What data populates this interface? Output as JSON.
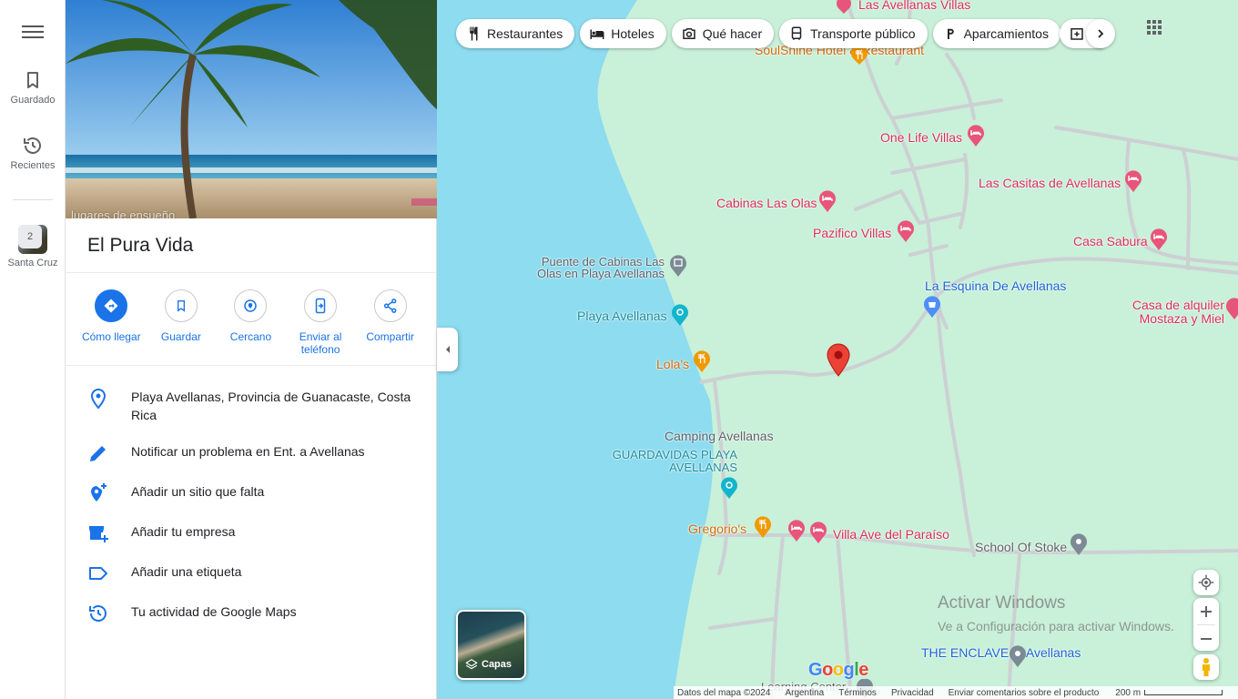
{
  "rail": {
    "saved_label": "Guardado",
    "recent_label": "Recientes",
    "recent_place_label": "Santa Cruz",
    "recent_badge": "2"
  },
  "panel": {
    "hero_caption": "lugares de ensueño",
    "title": "El Pura Vida",
    "actions": [
      {
        "label": "Cómo llegar",
        "icon": "directions-icon"
      },
      {
        "label": "Guardar",
        "icon": "bookmark-icon"
      },
      {
        "label": "Cercano",
        "icon": "nearby-icon"
      },
      {
        "label": "Enviar al teléfono",
        "icon": "send-to-phone-icon"
      },
      {
        "label": "Compartir",
        "icon": "share-icon"
      }
    ],
    "info": [
      {
        "text": "Playa Avellanas, Provincia de Guanacaste, Costa Rica",
        "icon": "location-pin-icon"
      },
      {
        "text": "Notificar un problema en Ent. a Avellanas",
        "icon": "pencil-icon"
      },
      {
        "text": "Añadir un sitio que falta",
        "icon": "add-place-icon"
      },
      {
        "text": "Añadir tu empresa",
        "icon": "add-business-icon"
      },
      {
        "text": "Añadir una etiqueta",
        "icon": "label-icon"
      },
      {
        "text": "Tu actividad de Google Maps",
        "icon": "history-icon"
      }
    ]
  },
  "chips": [
    {
      "label": "Restaurantes",
      "icon": "fork-knife-icon"
    },
    {
      "label": "Hoteles",
      "icon": "bed-icon"
    },
    {
      "label": "Qué hacer",
      "icon": "camera-icon"
    },
    {
      "label": "Transporte público",
      "icon": "bus-icon"
    },
    {
      "label": "Aparcamientos",
      "icon": "parking-icon"
    }
  ],
  "map": {
    "pois": {
      "las_avellanas_villas": "Las Avellanas Villas",
      "soulshine": "SoulShine Hotel & Restaurant",
      "one_life": "One Life Villas",
      "casitas": "Las Casitas de Avellanas",
      "cabinas_olas": "Cabinas Las Olas",
      "pazifico": "Pazifico Villas",
      "casa_sabura": "Casa Sabura",
      "puente": "Puente de Cabinas Las Olas en Playa Avellanas",
      "esquina": "La Esquina De Avellanas",
      "casa_alquiler": "Casa de alquiler Mostaza y Miel",
      "playa": "Playa Avellanas",
      "lolas": "Lola's",
      "camping": "Camping Avellanas",
      "guardavidas": "GUARDAVIDAS PLAYA AVELLANAS",
      "gregorios": "Gregorio's",
      "villa_ave": "Villa Ave del Paraíso",
      "school": "School Of Stoke",
      "enclave": "THE ENCLAVE at Avellanas",
      "learning": "Learning Center"
    },
    "layers_label": "Capas",
    "watermark_title": "Activar Windows",
    "watermark_sub": "Ve a Configuración para activar Windows.",
    "logo": "Google",
    "footer": {
      "data": "Datos del mapa ©2024",
      "country": "Argentina",
      "terms": "Términos",
      "privacy": "Privacidad",
      "feedback": "Enviar comentarios sobre el producto",
      "scale": "200 m"
    },
    "colors": {
      "water": "#8ddcef",
      "land": "#c9f0d9",
      "road": "#ccd0d3",
      "marker": "#ea4335",
      "accent": "#1a73e8"
    }
  }
}
